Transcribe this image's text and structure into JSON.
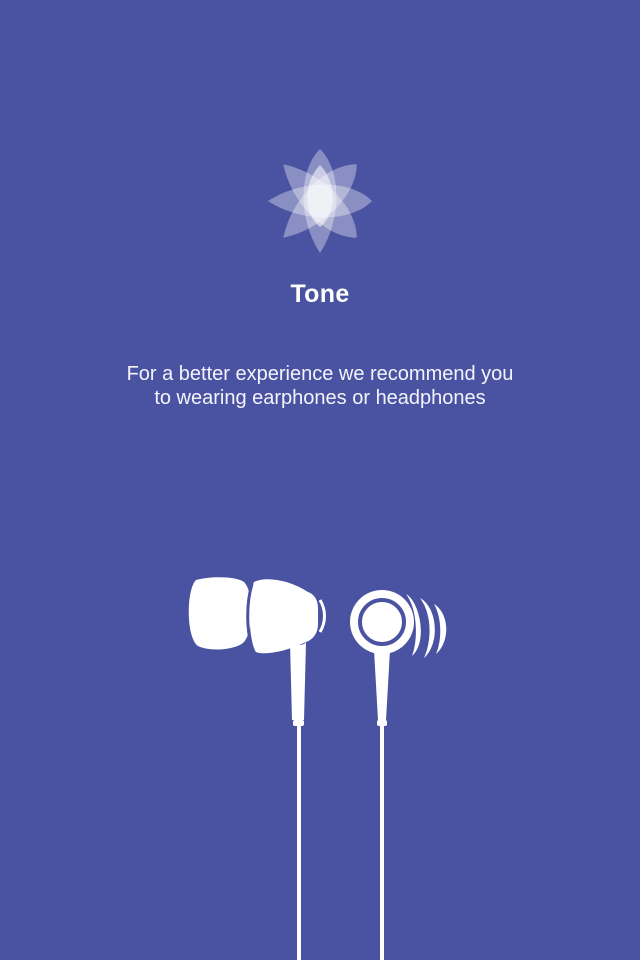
{
  "app": {
    "name": "Tone",
    "logo_icon": "flower-logo-icon"
  },
  "onboarding": {
    "message": "For a better experience we recommend you to wearing earphones or headphones",
    "illustration_icon": "earphones-icon"
  },
  "colors": {
    "background": "#4a53a2",
    "foreground": "#ffffff"
  }
}
